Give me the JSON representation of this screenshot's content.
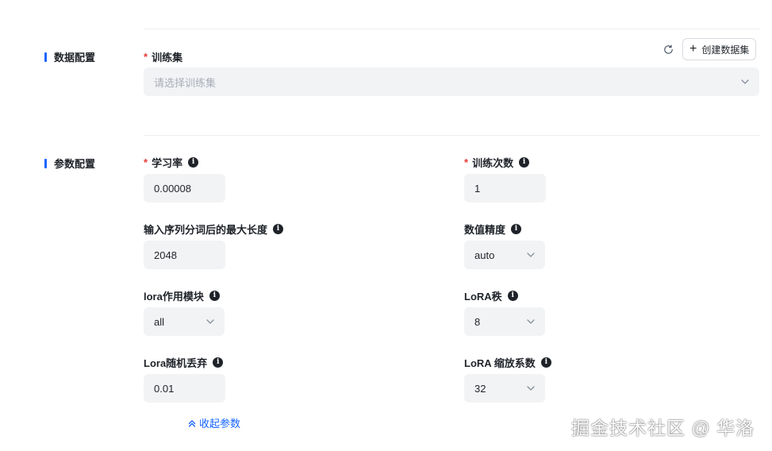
{
  "data_section": {
    "title": "数据配置",
    "train_set_label": "训练集",
    "required_mark": "*",
    "train_set_placeholder": "请选择训练集",
    "create_dataset_button": "创建数据集"
  },
  "params_section": {
    "title": "参数配置",
    "learning_rate": {
      "label": "学习率",
      "value": "0.00008"
    },
    "train_epochs": {
      "label": "训练次数",
      "value": "1"
    },
    "max_seq_length": {
      "label": "输入序列分词后的最大长度",
      "value": "2048"
    },
    "precision": {
      "label": "数值精度",
      "value": "auto"
    },
    "lora_target": {
      "label": "lora作用模块",
      "value": "all"
    },
    "lora_rank": {
      "label": "LoRA秩",
      "value": "8"
    },
    "lora_dropout": {
      "label": "Lora随机丢弃",
      "value": "0.01"
    },
    "lora_alpha": {
      "label": "LoRA 缩放系数",
      "value": "32"
    },
    "collapse_link": "收起参数"
  },
  "icons": {
    "info": "info-icon",
    "chevron": "chevron-down-icon",
    "refresh": "refresh-icon",
    "plus": "plus-icon",
    "collapse": "double-chevron-up-icon"
  },
  "colors": {
    "accent": "#1664ff",
    "required": "#e53935",
    "input_bg": "#f2f3f5",
    "text": "#1f2329",
    "placeholder": "#a9aeb8"
  },
  "watermark": "掘金技术社区 @ 华洛"
}
